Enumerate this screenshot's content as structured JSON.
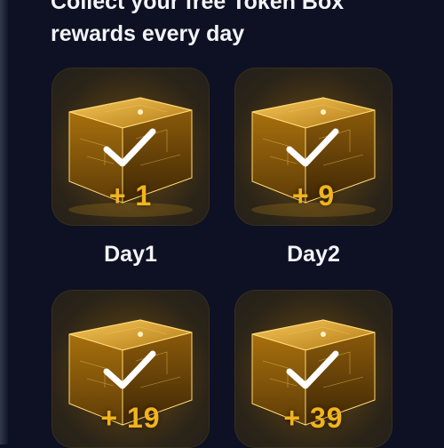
{
  "header": {
    "title_line1": "Collect your free Token Box",
    "title_line2": "rewards every day"
  },
  "rewards": [
    {
      "amount": "+ 1",
      "day": "Day1",
      "claimed": true
    },
    {
      "amount": "+ 9",
      "day": "Day2",
      "claimed": true
    },
    {
      "amount": "+ 19",
      "day": "",
      "claimed": true
    },
    {
      "amount": "+ 39",
      "day": "",
      "claimed": true
    }
  ],
  "colors": {
    "background": "#0e1123",
    "accent_gold": "#f2b41c",
    "text": "#f3f4f7"
  },
  "icons": {
    "cube": "token-box-icon",
    "check": "check-icon"
  }
}
